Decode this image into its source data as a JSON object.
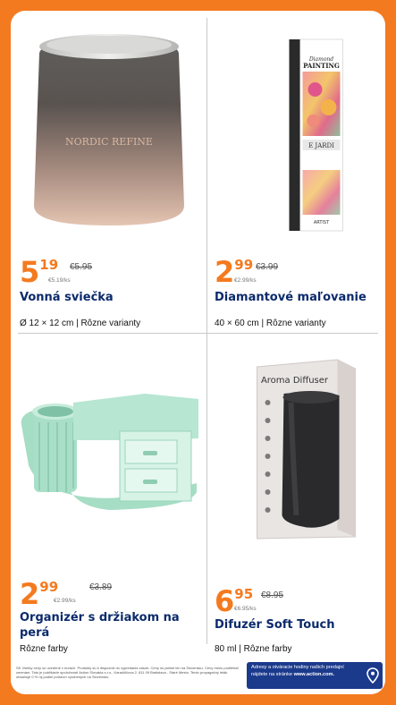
{
  "products": [
    {
      "price_int": "5",
      "price_dec": "19",
      "old_price": "€5.95",
      "unit_price": "€5.19/ks",
      "title": "Vonná sviečka",
      "description": "Ø 12 × 12 cm | Rôzne varianty",
      "image": "scented-candle-image",
      "brand_on_product": "NORDIC REFINE"
    },
    {
      "price_int": "2",
      "price_dec": "99",
      "old_price": "€3.99",
      "unit_price": "€2.99/ks",
      "title": "Diamantové maľovanie",
      "description": "40 × 60 cm | Rôzne varianty",
      "image": "diamond-painting-box-image",
      "box_text": [
        "Diamond",
        "PAINTING",
        "E JARDI",
        "ARTIST"
      ]
    },
    {
      "price_int": "2",
      "price_dec": "99",
      "old_price": "€3.89",
      "unit_price": "€2.99/ks",
      "title": "Organizér s držiakom na perá",
      "description": "Rôzne farby",
      "image": "desk-organizer-image"
    },
    {
      "price_int": "6",
      "price_dec": "95",
      "old_price": "€8.95",
      "unit_price": "€6.95/ks",
      "title": "Difuzér Soft Touch",
      "description": "80 ml | Rôzne farby",
      "image": "aroma-diffuser-image",
      "box_label": "Aroma Diffuser"
    }
  ],
  "footer": {
    "legal": "SK Všetky ceny sú uvedené v eurách. Produkty sú k dispozícii do vypredania zásob. Ceny sú platné len na Slovensku. Ceny môžu podliehať zmenám. Tato je publikácie spoločnosti Action Slovakia s.r.o., Karadžičova 2, 811 09 Bratislava - Staré Mesto. Tento propagačný leták obsahuje 0 % nij podiel potravín vyrobených na Slovensku.",
    "store_line1": "Adresy a otváracie hodiny našich predajní",
    "store_line2_prefix": "nájdete na stránke",
    "store_url": "www.action.com.",
    "icon": "location-pin-icon"
  },
  "colors": {
    "background": "#f47a1f",
    "price": "#f47a1f",
    "title": "#0b2a6b",
    "store_box": "#1b3a8c"
  }
}
